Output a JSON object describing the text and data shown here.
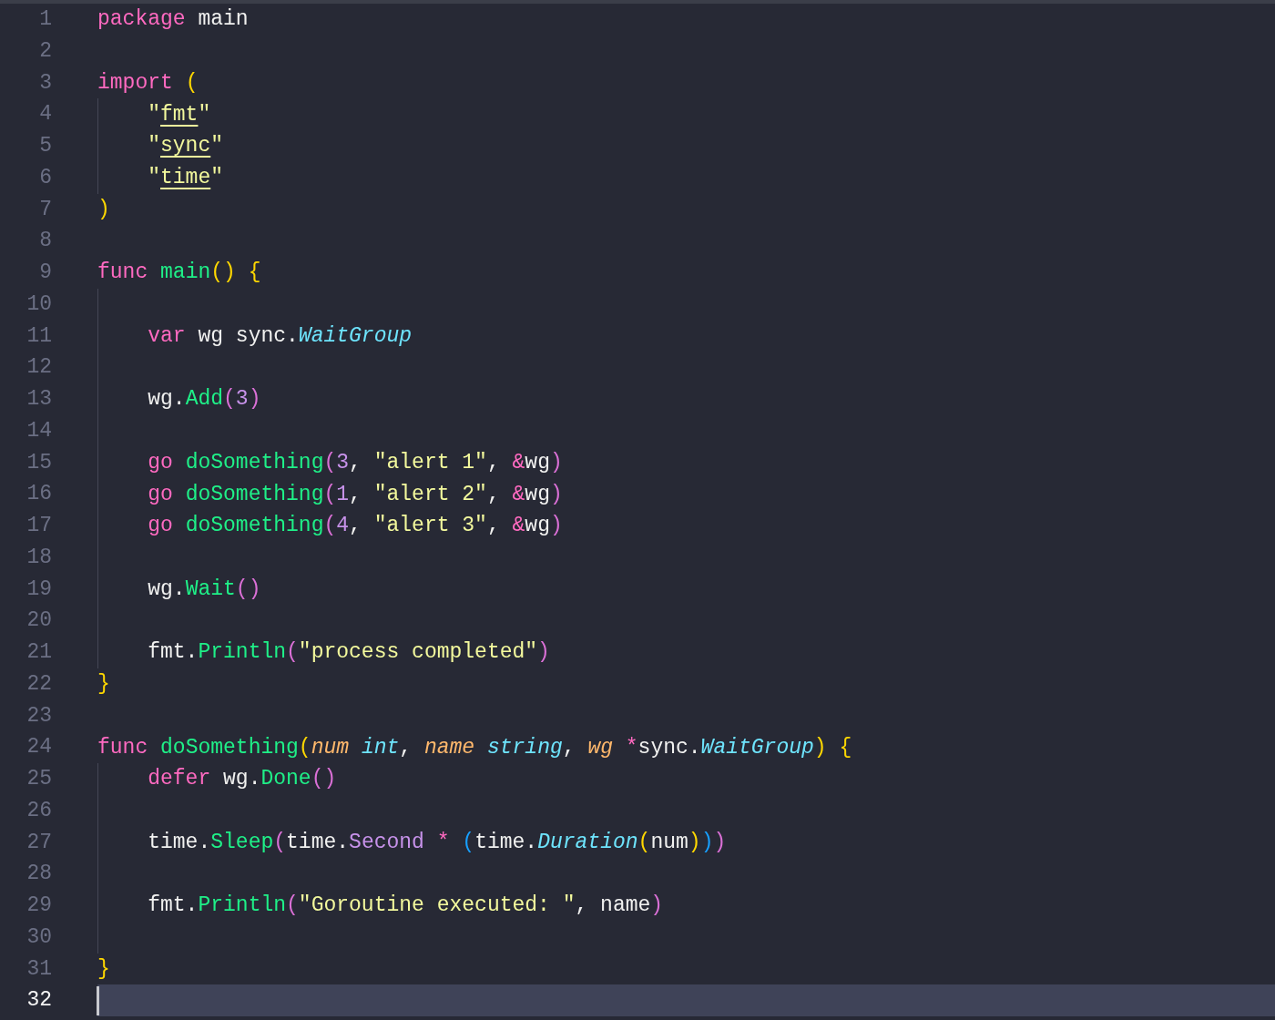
{
  "editor": {
    "lines": [
      {
        "number": "1",
        "selected": false,
        "guide": false,
        "tokens": [
          {
            "text": "package",
            "kind": "keyword"
          },
          {
            "text": " main",
            "kind": "plain"
          }
        ]
      },
      {
        "number": "2",
        "selected": false,
        "guide": false
      },
      {
        "number": "3",
        "selected": false,
        "guide": false,
        "tokens": [
          {
            "text": "import",
            "kind": "keyword"
          },
          {
            "text": " (",
            "kind": "bracket1"
          }
        ]
      },
      {
        "number": "4",
        "selected": false,
        "guide": true,
        "tokens": [
          {
            "text": "    \"",
            "kind": "string"
          },
          {
            "text": "fmt",
            "kind": "path"
          },
          {
            "text": "\"",
            "kind": "string"
          }
        ]
      },
      {
        "number": "5",
        "selected": false,
        "guide": true,
        "tokens": [
          {
            "text": "    \"",
            "kind": "string"
          },
          {
            "text": "sync",
            "kind": "path"
          },
          {
            "text": "\"",
            "kind": "string"
          }
        ]
      },
      {
        "number": "6",
        "selected": false,
        "guide": true,
        "tokens": [
          {
            "text": "    \"",
            "kind": "string"
          },
          {
            "text": "time",
            "kind": "path"
          },
          {
            "text": "\"",
            "kind": "string"
          }
        ]
      },
      {
        "number": "7",
        "selected": false,
        "guide": false,
        "tokens": [
          {
            "text": ")",
            "kind": "bracket1"
          }
        ]
      },
      {
        "number": "8",
        "selected": false,
        "guide": false
      },
      {
        "number": "9",
        "selected": false,
        "guide": false,
        "tokens": [
          {
            "text": "func",
            "kind": "keyword"
          },
          {
            "text": " main",
            "kind": "function"
          },
          {
            "text": "()",
            "kind": "bracket1"
          },
          {
            "text": " {",
            "kind": "bracket1"
          }
        ]
      },
      {
        "number": "10",
        "selected": false,
        "guide": true
      },
      {
        "number": "11",
        "selected": false,
        "guide": true,
        "tokens": [
          {
            "text": "    var",
            "kind": "keyword"
          },
          {
            "text": " wg sync.",
            "kind": "plain"
          },
          {
            "text": "WaitGroup",
            "kind": "type"
          }
        ]
      },
      {
        "number": "12",
        "selected": false,
        "guide": true
      },
      {
        "number": "13",
        "selected": false,
        "guide": true,
        "tokens": [
          {
            "text": "    wg.",
            "kind": "plain"
          },
          {
            "text": "Add",
            "kind": "function"
          },
          {
            "text": "(",
            "kind": "bracket2"
          },
          {
            "text": "3",
            "kind": "number"
          },
          {
            "text": ")",
            "kind": "bracket2"
          }
        ]
      },
      {
        "number": "14",
        "selected": false,
        "guide": true
      },
      {
        "number": "15",
        "selected": false,
        "guide": true,
        "tokens": [
          {
            "text": "    go",
            "kind": "keyword"
          },
          {
            "text": " doSomething",
            "kind": "function"
          },
          {
            "text": "(",
            "kind": "bracket2"
          },
          {
            "text": "3",
            "kind": "number"
          },
          {
            "text": ", ",
            "kind": "plain"
          },
          {
            "text": "\"alert 1\"",
            "kind": "string"
          },
          {
            "text": ", ",
            "kind": "plain"
          },
          {
            "text": "&",
            "kind": "operator"
          },
          {
            "text": "wg",
            "kind": "plain"
          },
          {
            "text": ")",
            "kind": "bracket2"
          }
        ]
      },
      {
        "number": "16",
        "selected": false,
        "guide": true,
        "tokens": [
          {
            "text": "    go",
            "kind": "keyword"
          },
          {
            "text": " doSomething",
            "kind": "function"
          },
          {
            "text": "(",
            "kind": "bracket2"
          },
          {
            "text": "1",
            "kind": "number"
          },
          {
            "text": ", ",
            "kind": "plain"
          },
          {
            "text": "\"alert 2\"",
            "kind": "string"
          },
          {
            "text": ", ",
            "kind": "plain"
          },
          {
            "text": "&",
            "kind": "operator"
          },
          {
            "text": "wg",
            "kind": "plain"
          },
          {
            "text": ")",
            "kind": "bracket2"
          }
        ]
      },
      {
        "number": "17",
        "selected": false,
        "guide": true,
        "tokens": [
          {
            "text": "    go",
            "kind": "keyword"
          },
          {
            "text": " doSomething",
            "kind": "function"
          },
          {
            "text": "(",
            "kind": "bracket2"
          },
          {
            "text": "4",
            "kind": "number"
          },
          {
            "text": ", ",
            "kind": "plain"
          },
          {
            "text": "\"alert 3\"",
            "kind": "string"
          },
          {
            "text": ", ",
            "kind": "plain"
          },
          {
            "text": "&",
            "kind": "operator"
          },
          {
            "text": "wg",
            "kind": "plain"
          },
          {
            "text": ")",
            "kind": "bracket2"
          }
        ]
      },
      {
        "number": "18",
        "selected": false,
        "guide": true
      },
      {
        "number": "19",
        "selected": false,
        "guide": true,
        "tokens": [
          {
            "text": "    wg.",
            "kind": "plain"
          },
          {
            "text": "Wait",
            "kind": "function"
          },
          {
            "text": "()",
            "kind": "bracket2"
          }
        ]
      },
      {
        "number": "20",
        "selected": false,
        "guide": true
      },
      {
        "number": "21",
        "selected": false,
        "guide": true,
        "tokens": [
          {
            "text": "    fmt.",
            "kind": "plain"
          },
          {
            "text": "Println",
            "kind": "function"
          },
          {
            "text": "(",
            "kind": "bracket2"
          },
          {
            "text": "\"process completed\"",
            "kind": "string"
          },
          {
            "text": ")",
            "kind": "bracket2"
          }
        ]
      },
      {
        "number": "22",
        "selected": false,
        "guide": false,
        "tokens": [
          {
            "text": "}",
            "kind": "bracket1"
          }
        ]
      },
      {
        "number": "23",
        "selected": false,
        "guide": false
      },
      {
        "number": "24",
        "selected": false,
        "guide": false,
        "tokens": [
          {
            "text": "func",
            "kind": "keyword"
          },
          {
            "text": " doSomething",
            "kind": "function"
          },
          {
            "text": "(",
            "kind": "bracket1"
          },
          {
            "text": "num",
            "kind": "param"
          },
          {
            "text": " int",
            "kind": "type"
          },
          {
            "text": ", ",
            "kind": "plain"
          },
          {
            "text": "name",
            "kind": "param"
          },
          {
            "text": " string",
            "kind": "type"
          },
          {
            "text": ", ",
            "kind": "plain"
          },
          {
            "text": "wg",
            "kind": "param"
          },
          {
            "text": " *",
            "kind": "operator"
          },
          {
            "text": "sync.",
            "kind": "plain"
          },
          {
            "text": "WaitGroup",
            "kind": "type"
          },
          {
            "text": ")",
            "kind": "bracket1"
          },
          {
            "text": " {",
            "kind": "bracket1"
          }
        ]
      },
      {
        "number": "25",
        "selected": false,
        "guide": true,
        "tokens": [
          {
            "text": "    defer",
            "kind": "keyword"
          },
          {
            "text": " wg.",
            "kind": "plain"
          },
          {
            "text": "Done",
            "kind": "function"
          },
          {
            "text": "()",
            "kind": "bracket2"
          }
        ]
      },
      {
        "number": "26",
        "selected": false,
        "guide": true
      },
      {
        "number": "27",
        "selected": false,
        "guide": true,
        "tokens": [
          {
            "text": "    time.",
            "kind": "plain"
          },
          {
            "text": "Sleep",
            "kind": "function"
          },
          {
            "text": "(",
            "kind": "bracket2"
          },
          {
            "text": "time.",
            "kind": "plain"
          },
          {
            "text": "Second",
            "kind": "constant"
          },
          {
            "text": " * ",
            "kind": "operator"
          },
          {
            "text": "(",
            "kind": "bracket3"
          },
          {
            "text": "time.",
            "kind": "plain"
          },
          {
            "text": "Duration",
            "kind": "type"
          },
          {
            "text": "(",
            "kind": "bracket1"
          },
          {
            "text": "num",
            "kind": "plain"
          },
          {
            "text": ")",
            "kind": "bracket1"
          },
          {
            "text": ")",
            "kind": "bracket3"
          },
          {
            "text": ")",
            "kind": "bracket2"
          }
        ]
      },
      {
        "number": "28",
        "selected": false,
        "guide": true
      },
      {
        "number": "29",
        "selected": false,
        "guide": true,
        "tokens": [
          {
            "text": "    fmt.",
            "kind": "plain"
          },
          {
            "text": "Println",
            "kind": "function"
          },
          {
            "text": "(",
            "kind": "bracket2"
          },
          {
            "text": "\"Goroutine executed: \"",
            "kind": "string"
          },
          {
            "text": ", name",
            "kind": "plain"
          },
          {
            "text": ")",
            "kind": "bracket2"
          }
        ]
      },
      {
        "number": "30",
        "selected": false,
        "guide": true
      },
      {
        "number": "31",
        "selected": false,
        "guide": false,
        "tokens": [
          {
            "text": "}",
            "kind": "bracket1"
          }
        ]
      },
      {
        "number": "32",
        "selected": true,
        "guide": false
      }
    ]
  }
}
